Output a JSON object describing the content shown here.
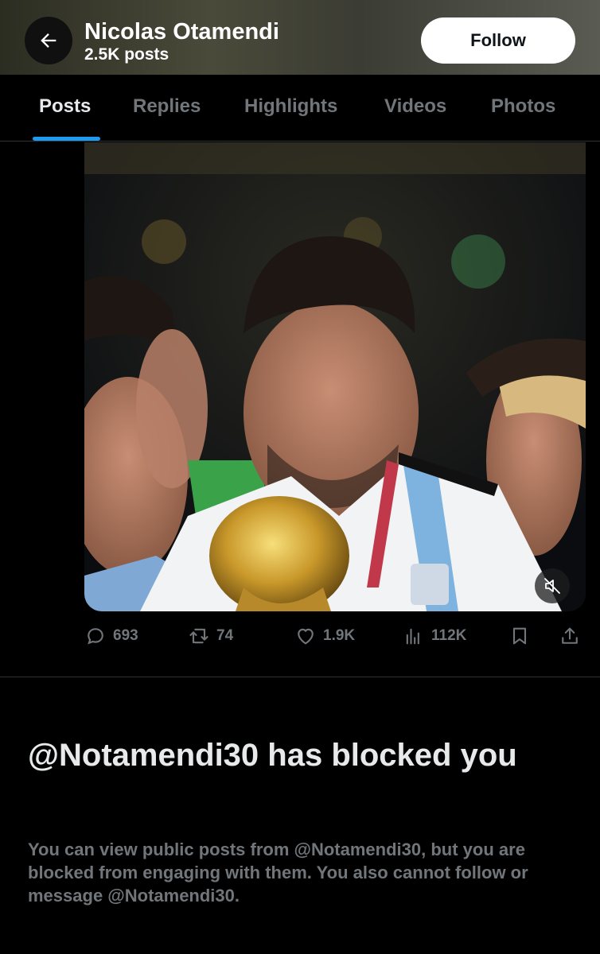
{
  "header": {
    "profile_name": "Nicolas Otamendi",
    "post_count": "2.5K posts",
    "follow_label": "Follow",
    "back_icon": "arrow-left-icon"
  },
  "tabs": [
    {
      "label": "Posts",
      "active": true
    },
    {
      "label": "Replies",
      "active": false
    },
    {
      "label": "Highlights",
      "active": false
    },
    {
      "label": "Videos",
      "active": false
    },
    {
      "label": "Photos",
      "active": false
    }
  ],
  "post": {
    "media_icon": "mute-icon",
    "actions": {
      "replies": "693",
      "reposts": "74",
      "likes": "1.9K",
      "views": "112K"
    }
  },
  "blocked": {
    "title": "@Notamendi30 has blocked you",
    "text": "You can view public posts from @Notamendi30, but you are blocked from engaging with them. You also cannot follow or message @Notamendi30."
  },
  "colors": {
    "background": "#000000",
    "text_primary": "#e7e9ea",
    "text_secondary": "#71767b",
    "accent": "#1d9bf0"
  }
}
